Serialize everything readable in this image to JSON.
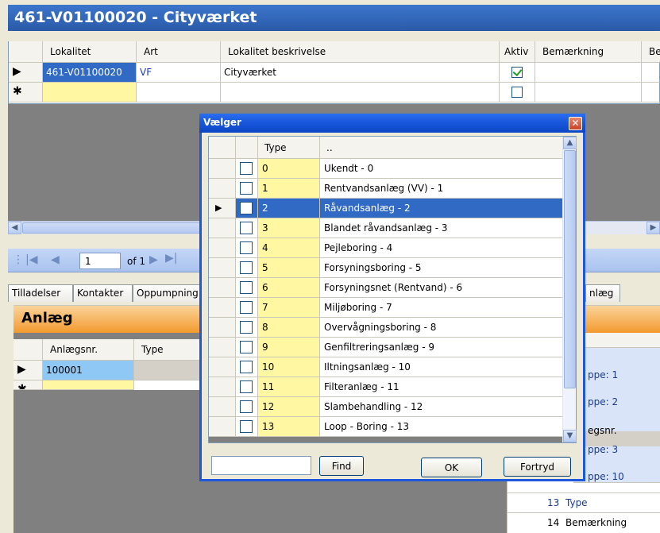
{
  "window": {
    "title": "461-V01100020 - Cityværket"
  },
  "top_grid": {
    "columns": [
      "Lokalitet",
      "Art",
      "Lokalitet beskrivelse",
      "Aktiv",
      "Bemærkning",
      "Be"
    ],
    "rows": [
      {
        "indicator": "▶",
        "lokalitet": "461-V01100020",
        "art": "VF",
        "beskrivelse": "Cityværket",
        "aktiv": true
      },
      {
        "indicator": "✱",
        "lokalitet": "",
        "art": "",
        "beskrivelse": "",
        "aktiv": false
      }
    ]
  },
  "navigator": {
    "position": "1",
    "of_label": "of 1"
  },
  "tabs": [
    "Tilladelser",
    "Kontakter",
    "Oppumpning",
    "nlæg"
  ],
  "anlaeg": {
    "title": "Anlæg",
    "columns": [
      "Anlægsnr.",
      "Type"
    ],
    "rows": [
      {
        "indicator": "▶",
        "anlaegsnr": "100001"
      },
      {
        "indicator": "✱",
        "anlaegsnr": ""
      }
    ],
    "right_panel": {
      "items": [
        "ppe: 1",
        "ppe: 2",
        "egsnr.",
        "ppe: 3",
        "ppe: 10"
      ],
      "numbered": [
        {
          "num": "13",
          "label": "Type"
        },
        {
          "num": "14",
          "label": "Bemærkning"
        }
      ]
    }
  },
  "dialog": {
    "title": "Vælger",
    "close_icon": "close-icon",
    "columns": {
      "type": "Type",
      "desc": ".."
    },
    "rows": [
      {
        "type": "0",
        "desc": "Ukendt - 0"
      },
      {
        "type": "1",
        "desc": "Rentvandsanlæg (VV) - 1"
      },
      {
        "type": "2",
        "desc": "Råvandsanlæg - 2",
        "selected": true
      },
      {
        "type": "3",
        "desc": "Blandet råvandsanlæg - 3"
      },
      {
        "type": "4",
        "desc": "Pejleboring - 4"
      },
      {
        "type": "5",
        "desc": "Forsyningsboring - 5"
      },
      {
        "type": "6",
        "desc": "Forsyningsnet (Rentvand) - 6"
      },
      {
        "type": "7",
        "desc": "Miljøboring - 7"
      },
      {
        "type": "8",
        "desc": "Overvågningsboring - 8"
      },
      {
        "type": "9",
        "desc": "Genfiltreringsanlæg - 9"
      },
      {
        "type": "10",
        "desc": "Iltningsanlæg - 10"
      },
      {
        "type": "11",
        "desc": "Filteranlæg - 11"
      },
      {
        "type": "12",
        "desc": "Slambehandling - 12"
      },
      {
        "type": "13",
        "desc": "Loop - Boring - 13"
      }
    ],
    "search_value": "",
    "find_label": "Find",
    "ok_label": "OK",
    "cancel_label": "Fortryd"
  },
  "colors": {
    "selection": "#316ac5",
    "key_column": "#fff7a1",
    "title_bar": "#2a6ef0",
    "anlaeg_header": "#f39a2e"
  }
}
